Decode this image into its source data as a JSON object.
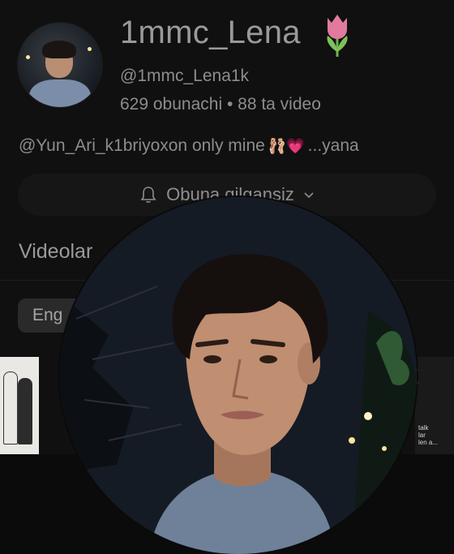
{
  "profile": {
    "name": "1mmc_Lena",
    "name_emoji": "tulip",
    "handle": "@1mmc_Lena1k",
    "stats": "629 obunachi • 88 ta video",
    "bio_text": "@Yun_Ari_k1briyoxon only mine",
    "bio_emojis": "🩰💗",
    "bio_more": "...yana",
    "avatar_alt": "profile-photo"
  },
  "subscribe": {
    "label": "Obuna qilgansiz",
    "icon": "bell-icon",
    "dropdown_icon": "chevron-down-icon"
  },
  "section": {
    "title": "Videolar"
  },
  "filters": {
    "chip_label": "Eng"
  },
  "thumbnails": {
    "right_caption": "talk\nlar\nlen a..."
  },
  "colors": {
    "background": "#0b0b0b",
    "text_dim": "#8d8d8d",
    "button_bg": "#161616",
    "tulip": "#e27a9b"
  }
}
